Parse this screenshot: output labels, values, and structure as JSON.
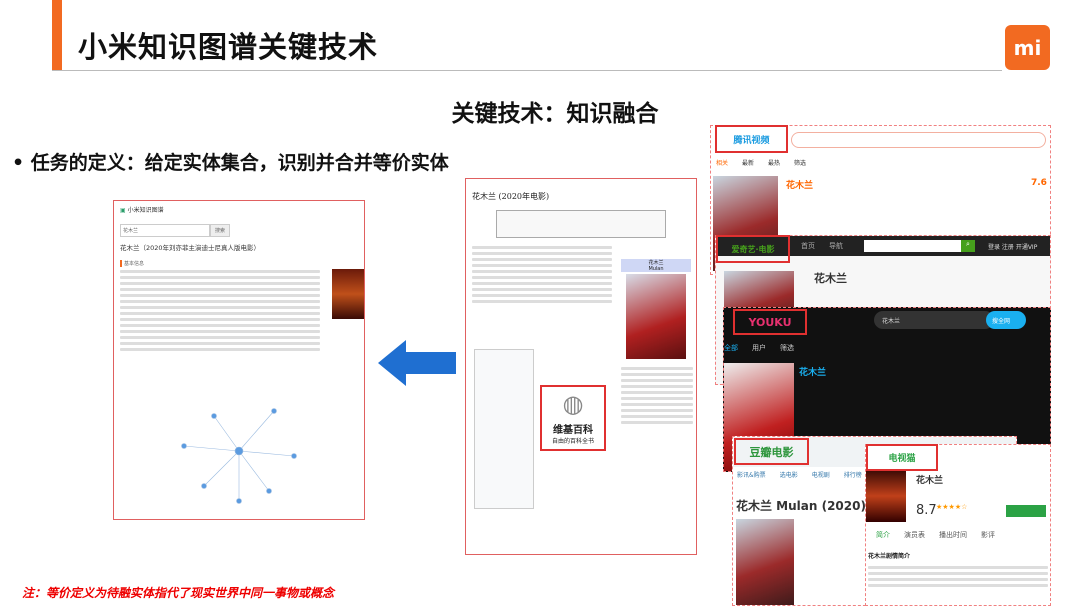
{
  "slide": {
    "title": "小米知识图谱关键技术",
    "logo": "mi",
    "subtitle": "关键技术：知识融合",
    "bullet": "任务的定义：给定实体集合，识别并合并等价实体",
    "note": "注：等价定义为待融实体指代了现实世界中同一事物或概念",
    "colors": {
      "accent": "#f26a21",
      "note": "#e00000",
      "arrow": "#1f6fd1",
      "highlight_box": "#e03030"
    }
  },
  "kg_screenshot": {
    "brand": "小米知识图谱",
    "search_value": "花木兰",
    "search_button": "搜索",
    "entity_title": "花木兰（2020年刘亦菲主演迪士尼真人版电影）",
    "section": "基本信息"
  },
  "wiki_screenshot": {
    "title": "花木兰 (2020年电影)",
    "infobox_title": "花木兰",
    "infobox_subtitle": "Mulan",
    "logo_text": "维基百科",
    "logo_sub": "自由的百科全书"
  },
  "video_sites": {
    "tencent": {
      "logo": "腾讯视频",
      "result_title": "花木兰",
      "score": "7.6",
      "tabs": [
        "相关",
        "最新",
        "最热",
        "筛选"
      ]
    },
    "iqiyi": {
      "logo": "爱奇艺·电影",
      "nav": [
        "首页",
        "导航"
      ],
      "result_title": "花木兰",
      "actions": "登录 注册 开通VIP"
    },
    "youku": {
      "logo": "YOUKU",
      "search_value": "花木兰",
      "search_button": "搜全网",
      "tabs": [
        "全部",
        "用户",
        "筛选"
      ],
      "result_title": "花木兰"
    },
    "douban": {
      "logo": "豆瓣电影",
      "tabs": [
        "影讯&购票",
        "选电影",
        "电视剧",
        "排行榜"
      ],
      "result_title": "花木兰 Mulan (2020)"
    },
    "tvmao": {
      "logo": "电视猫",
      "result_title": "花木兰",
      "score": "8.7",
      "tabs": [
        "简介",
        "演员表",
        "播出时间",
        "影评"
      ],
      "section": "花木兰剧情简介"
    }
  }
}
